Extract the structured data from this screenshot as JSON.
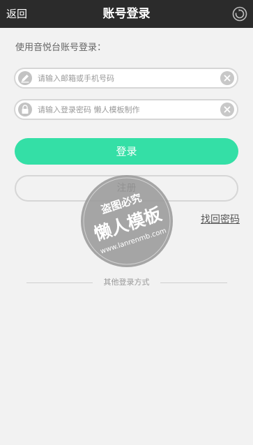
{
  "header": {
    "back_label": "返回",
    "title": "账号登录",
    "refresh_icon": "refresh-icon"
  },
  "form": {
    "prompt": "使用音悦台账号登录：",
    "username": {
      "icon": "pencil-icon",
      "placeholder": "请输入邮箱或手机号码",
      "value": ""
    },
    "password": {
      "icon": "lock-icon",
      "placeholder": "请输入登录密码 懒人模板制作",
      "value": ""
    },
    "clear_icon": "clear-icon"
  },
  "buttons": {
    "login_label": "登录",
    "register_label": "注册",
    "forgot_label": "找回密码"
  },
  "other_login": {
    "label": "其他登录方式"
  },
  "watermark": {
    "line1": "盗图必究",
    "line2": "懒人模板",
    "line3": "www.lanrenmb.com"
  },
  "colors": {
    "header_bg": "#2b2b2b",
    "accent": "#34dfa6",
    "page_bg": "#f2f2f2"
  }
}
